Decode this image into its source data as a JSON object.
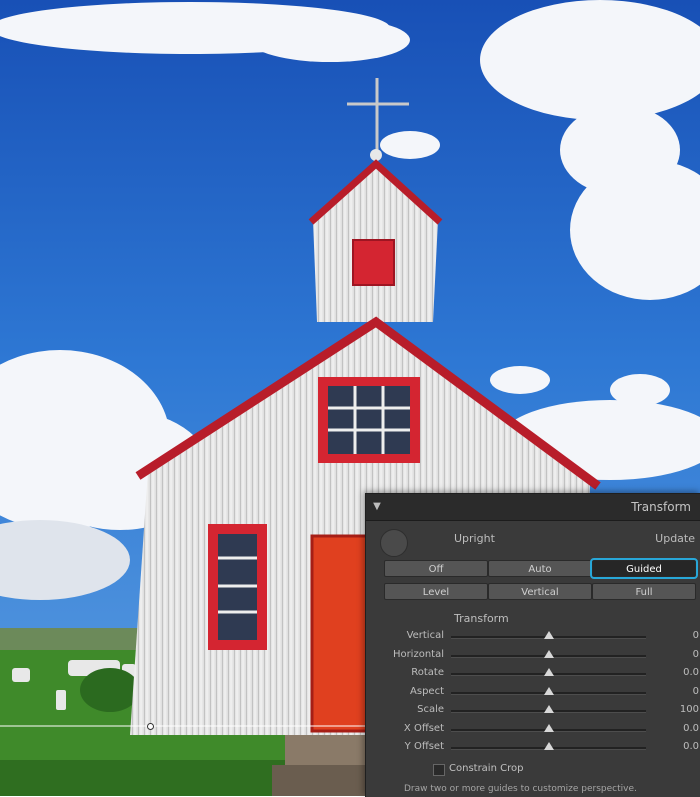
{
  "panel": {
    "title": "Transform",
    "upright_label": "Upright",
    "update_label": "Update",
    "modes_row1": [
      {
        "label": "Off",
        "selected": false
      },
      {
        "label": "Auto",
        "selected": false
      },
      {
        "label": "Guided",
        "selected": true
      }
    ],
    "modes_row2": [
      {
        "label": "Level",
        "selected": false
      },
      {
        "label": "Vertical",
        "selected": false
      },
      {
        "label": "Full",
        "selected": false
      }
    ],
    "section_label": "Transform",
    "sliders": [
      {
        "label": "Vertical",
        "value": "0",
        "position": 0.5
      },
      {
        "label": "Horizontal",
        "value": "0",
        "position": 0.5
      },
      {
        "label": "Rotate",
        "value": "0.0",
        "position": 0.5
      },
      {
        "label": "Aspect",
        "value": "0",
        "position": 0.5
      },
      {
        "label": "Scale",
        "value": "100",
        "position": 0.5
      },
      {
        "label": "X Offset",
        "value": "0.0",
        "position": 0.5
      },
      {
        "label": "Y Offset",
        "value": "0.0",
        "position": 0.5
      }
    ],
    "constrain_crop_label": "Constrain Crop",
    "constrain_crop_checked": false,
    "hint_text": "Draw two or more guides to customize perspective."
  },
  "colors": {
    "sky": "#1f63c4",
    "church_wall": "#ececec",
    "church_trim": "#c11f2a",
    "door": "#e0401f",
    "grass": "#3f8a2a",
    "accent": "#28a7d8"
  },
  "icons": {
    "collapse": "triangle-down-icon",
    "toggle": "toggle-knob-icon"
  }
}
